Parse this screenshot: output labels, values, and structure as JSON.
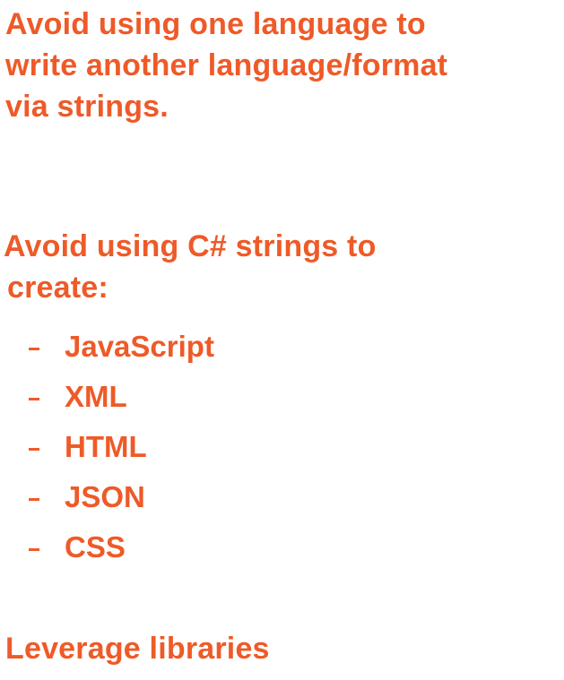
{
  "colors": {
    "text": "#EE5A28",
    "background": "#FFFFFF"
  },
  "point1": {
    "lines": [
      "Avoid using one language to",
      "write another language/format",
      "via strings."
    ]
  },
  "point2": {
    "lines": [
      "Avoid using C# strings to",
      "create:"
    ],
    "items": [
      "JavaScript",
      "XML",
      "HTML",
      "JSON",
      "CSS"
    ]
  },
  "point3": {
    "text": "Leverage libraries"
  }
}
